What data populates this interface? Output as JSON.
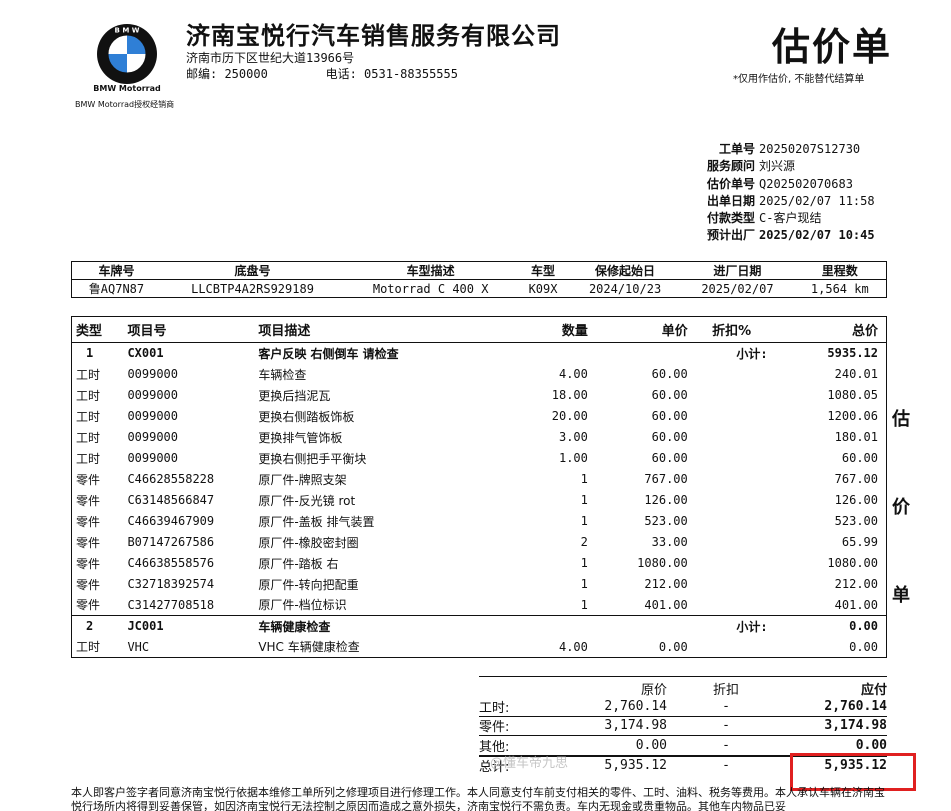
{
  "header": {
    "logo_text": "BMW Motorrad",
    "dealer_sub": "BMW Motorrad授权经销商",
    "company_name": "济南宝悦行汽车销售服务有限公司",
    "address": "济南市历下区世纪大道13966号",
    "postal_line": "邮编: 250000        电话: 0531-88355555",
    "doc_title": "估价单",
    "doc_note": "*仅用作估价, 不能替代结算单"
  },
  "meta": [
    {
      "label": "工单号",
      "value": "20250207S12730",
      "bold": false
    },
    {
      "label": "服务顾问",
      "value": "刘兴源",
      "bold": false
    },
    {
      "label": "估价单号",
      "value": "Q202502070683",
      "bold": false
    },
    {
      "label": "出单日期",
      "value": "2025/02/07 11:58",
      "bold": false
    },
    {
      "label": "付款类型",
      "value": "C-客户现结",
      "bold": false
    },
    {
      "label": "预计出厂",
      "value": "2025/02/07 10:45",
      "bold": true
    }
  ],
  "vehicle": {
    "headers": [
      "车牌号",
      "底盘号",
      "车型描述",
      "车型",
      "保修起始日",
      "进厂日期",
      "里程数"
    ],
    "values": [
      "鲁AQ7N87",
      "LLCBTP4A2RS929189",
      "Motorrad C 400 X",
      "K09X",
      "2024/10/23",
      "2025/02/07",
      "1,564 km"
    ]
  },
  "items_table": {
    "headers": [
      "类型",
      "项目号",
      "项目描述",
      "数量",
      "单价",
      "折扣%",
      "总价"
    ],
    "rows": [
      {
        "group": true,
        "sep": false,
        "type": "1",
        "code": "CX001",
        "desc": "客户反映 右侧倒车 请检查",
        "qty": "",
        "price": "",
        "disc": "小计:",
        "total": "5935.12"
      },
      {
        "group": false,
        "sep": false,
        "type": "工时",
        "code": "0099000",
        "desc": "车辆检查",
        "qty": "4.00",
        "price": "60.00",
        "disc": "",
        "total": "240.01"
      },
      {
        "group": false,
        "sep": false,
        "type": "工时",
        "code": "0099000",
        "desc": "更换后挡泥瓦",
        "qty": "18.00",
        "price": "60.00",
        "disc": "",
        "total": "1080.05"
      },
      {
        "group": false,
        "sep": false,
        "type": "工时",
        "code": "0099000",
        "desc": "更换右侧踏板饰板",
        "qty": "20.00",
        "price": "60.00",
        "disc": "",
        "total": "1200.06"
      },
      {
        "group": false,
        "sep": false,
        "type": "工时",
        "code": "0099000",
        "desc": "更换排气管饰板",
        "qty": "3.00",
        "price": "60.00",
        "disc": "",
        "total": "180.01"
      },
      {
        "group": false,
        "sep": false,
        "type": "工时",
        "code": "0099000",
        "desc": "更换右侧把手平衡块",
        "qty": "1.00",
        "price": "60.00",
        "disc": "",
        "total": "60.00"
      },
      {
        "group": false,
        "sep": false,
        "type": "零件",
        "code": "C46628558228",
        "desc": "原厂件-牌照支架",
        "qty": "1",
        "price": "767.00",
        "disc": "",
        "total": "767.00"
      },
      {
        "group": false,
        "sep": false,
        "type": "零件",
        "code": "C63148566847",
        "desc": "原厂件-反光镜 rot",
        "qty": "1",
        "price": "126.00",
        "disc": "",
        "total": "126.00"
      },
      {
        "group": false,
        "sep": false,
        "type": "零件",
        "code": "C46639467909",
        "desc": "原厂件-盖板 排气装置",
        "qty": "1",
        "price": "523.00",
        "disc": "",
        "total": "523.00"
      },
      {
        "group": false,
        "sep": false,
        "type": "零件",
        "code": "B07147267586",
        "desc": "原厂件-橡胶密封圈",
        "qty": "2",
        "price": "33.00",
        "disc": "",
        "total": "65.99"
      },
      {
        "group": false,
        "sep": false,
        "type": "零件",
        "code": "C46638558576",
        "desc": "原厂件-踏板 右",
        "qty": "1",
        "price": "1080.00",
        "disc": "",
        "total": "1080.00"
      },
      {
        "group": false,
        "sep": false,
        "type": "零件",
        "code": "C32718392574",
        "desc": "原厂件-转向把配重",
        "qty": "1",
        "price": "212.00",
        "disc": "",
        "total": "212.00"
      },
      {
        "group": false,
        "sep": false,
        "type": "零件",
        "code": "C31427708518",
        "desc": "原厂件-档位标识",
        "qty": "1",
        "price": "401.00",
        "disc": "",
        "total": "401.00"
      },
      {
        "group": true,
        "sep": true,
        "type": "2",
        "code": "JC001",
        "desc": "车辆健康检查",
        "qty": "",
        "price": "",
        "disc": "小计:",
        "total": "0.00"
      },
      {
        "group": false,
        "sep": false,
        "type": "工时",
        "code": "VHC",
        "desc": "VHC 车辆健康检查",
        "qty": "4.00",
        "price": "0.00",
        "disc": "",
        "total": "0.00"
      }
    ]
  },
  "side_title": [
    "估",
    "价",
    "单"
  ],
  "summary": {
    "headers": [
      "原价",
      "折扣",
      "应付"
    ],
    "rows": [
      {
        "label": "工时:",
        "orig": "2,760.14",
        "disc": "-",
        "due": "2,760.14"
      },
      {
        "label": "零件:",
        "orig": "3,174.98",
        "disc": "-",
        "due": "3,174.98"
      },
      {
        "label": "其他:",
        "orig": "0.00",
        "disc": "-",
        "due": "0.00"
      },
      {
        "label": "总计:",
        "orig": "5,935.12",
        "disc": "-",
        "due": "5,935.12"
      }
    ]
  },
  "disclaimer": "本人即客户签字者同意济南宝悦行依据本维修工单所列之修理项目进行修理工作。本人同意支付车前支付相关的零件、工时、油料、税务等费用。本人承认车辆在济南宝悦行场所内将得到妥善保管，如因济南宝悦行无法控制之原因而造成之意外损失，济南宝悦行不需负责。车内无现金或贵重物品。其他车内物品已妥",
  "watermark": "@懂车帝九思",
  "colors": {
    "highlight_box": "#e02020"
  }
}
